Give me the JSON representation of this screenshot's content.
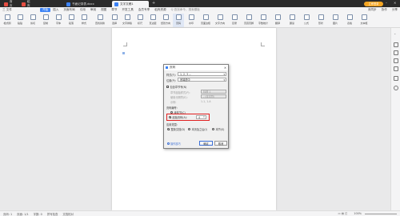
{
  "titlebar": {
    "tabs": [
      {
        "label": "首页",
        "color": "#e54d42"
      },
      {
        "label": "稻壳",
        "color": "#e54d42"
      },
      {
        "label": "书面记录表.docx",
        "color": "#3b82f6"
      },
      {
        "label": "文字文稿1",
        "color": "#3b82f6"
      }
    ],
    "right_badge": "立即登录"
  },
  "menubar": {
    "items": [
      "三 文件",
      "开始",
      "插入",
      "页面布局",
      "引用",
      "审阅",
      "视图",
      "章节",
      "开发工具",
      "会员专享",
      "稻壳资源"
    ],
    "selected_index": 1,
    "search_placeholder": "Q 查找命令、搜索模板",
    "right_items": [
      "未同步",
      "协作",
      "分享"
    ]
  },
  "ribbon": {
    "buttons": [
      "格式刷",
      "粘贴",
      "剪切",
      "复制",
      "字体",
      "段落",
      "样式",
      "查找替换",
      "选择",
      "文字排版",
      "标尺",
      "页边距",
      "纸张方向",
      "纸张大小",
      "分栏",
      "页码",
      "水印",
      "页面边框",
      "主题",
      "背景",
      "稿纸",
      "文字方向",
      "目录",
      "分隔符",
      "页眉页脚",
      "行号",
      "字数统计",
      "翻译",
      "朗读",
      "公式",
      "形状",
      "图片",
      "表格",
      "文本框"
    ]
  },
  "dialog": {
    "title": "页码",
    "style_label": "样式(F):",
    "style_value": "1, 2, 3 ...",
    "position_label": "位置(P):",
    "position_value": "底端居中",
    "include_chapter_label": "包含章节号(N)",
    "chapter_start_label": "章节起始样式(P):",
    "chapter_start_value": "标题 1",
    "separator_label": "使用分隔符(E):",
    "separator_value": "- (连字符)",
    "example_label": "示例:",
    "example_value": "1-1, 1-A",
    "numbering_label": "页码编号:",
    "continue_label": "续前节(C)",
    "start_at_label": "起始页码(A):",
    "start_at_value": "4",
    "apply_label": "应用范围:",
    "apply_options": [
      "整篇文档(D)",
      "本页及之后(I)",
      "本节(S)"
    ],
    "tips_label": "操作技巧",
    "ok_label": "确定",
    "cancel_label": "取消",
    "highlight_color": "#e02020"
  },
  "statusbar": {
    "page": "页码: 1",
    "pages": "页面: 1/1",
    "words": "字数: 0",
    "spell": "拼写检查",
    "proof": "文档校对",
    "zoom": "100%"
  }
}
